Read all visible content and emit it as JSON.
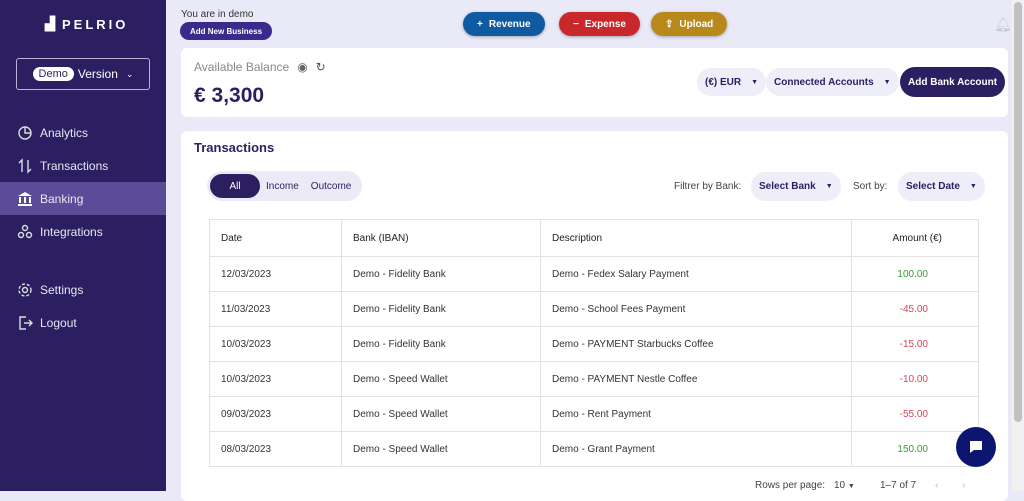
{
  "sidebar": {
    "logo": "PELRIO",
    "demo_pill": "Demo",
    "version": "Version",
    "items": [
      {
        "label": "Analytics",
        "icon": "pie-chart-icon"
      },
      {
        "label": "Transactions",
        "icon": "arrows-updown-icon"
      },
      {
        "label": "Banking",
        "icon": "bank-icon",
        "active": true
      },
      {
        "label": "Integrations",
        "icon": "integrations-icon"
      },
      {
        "label": "Settings",
        "icon": "gear-icon"
      },
      {
        "label": "Logout",
        "icon": "logout-icon"
      }
    ]
  },
  "topbar": {
    "demo_text": "You are in demo",
    "add_business": "Add New Business",
    "revenue": "Revenue",
    "expense": "Expense",
    "upload": "Upload"
  },
  "colors": {
    "revenue": "#0f5aa0",
    "expense": "#c8282c",
    "upload": "#b8891a",
    "primary": "#2b1f62"
  },
  "balance": {
    "label": "Available Balance",
    "value": "€ 3,300",
    "currency": "(€) EUR",
    "accounts": "Connected Accounts",
    "add_bank": "Add Bank Account"
  },
  "transactions": {
    "title": "Transactions",
    "filters": [
      "All",
      "Income",
      "Outcome"
    ],
    "filter_bank_label": "Filtrer by Bank:",
    "select_bank": "Select Bank",
    "sort_label": "Sort by:",
    "sort_value": "Select Date",
    "columns": [
      "Date",
      "Bank (IBAN)",
      "Description",
      "Amount (€)"
    ],
    "rows": [
      [
        "12/03/2023",
        "Demo - Fidelity Bank",
        "Demo - Fedex Salary Payment",
        "100.00"
      ],
      [
        "11/03/2023",
        "Demo - Fidelity Bank",
        "Demo - School Fees Payment",
        "-45.00"
      ],
      [
        "10/03/2023",
        "Demo - Fidelity Bank",
        "Demo - PAYMENT Starbucks Coffee",
        "-15.00"
      ],
      [
        "10/03/2023",
        "Demo - Speed Wallet",
        "Demo - PAYMENT Nestle Coffee",
        "-10.00"
      ],
      [
        "09/03/2023",
        "Demo - Speed Wallet",
        "Demo - Rent Payment",
        "-55.00"
      ],
      [
        "08/03/2023",
        "Demo - Speed Wallet",
        "Demo - Grant Payment",
        "150.00"
      ]
    ],
    "rows_per_page_label": "Rows per page:",
    "rows_per_page": "10",
    "range": "1–7 of 7"
  }
}
